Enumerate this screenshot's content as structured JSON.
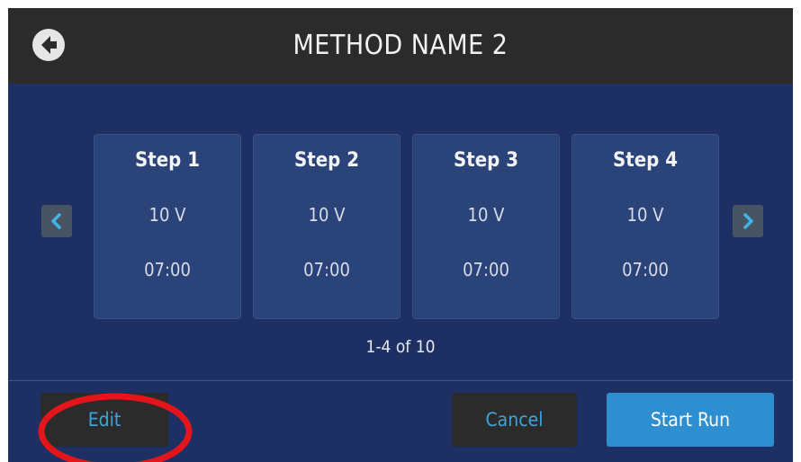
{
  "header": {
    "title": "METHOD NAME 2",
    "back_icon": "back-arrow-circle-icon"
  },
  "steps": [
    {
      "name": "Step 1",
      "voltage": "10 V",
      "time": "07:00"
    },
    {
      "name": "Step 2",
      "voltage": "10 V",
      "time": "07:00"
    },
    {
      "name": "Step 3",
      "voltage": "10 V",
      "time": "07:00"
    },
    {
      "name": "Step 4",
      "voltage": "10 V",
      "time": "07:00"
    }
  ],
  "nav": {
    "prev_icon": "chevron-left-icon",
    "next_icon": "chevron-right-icon",
    "pager": "1-4 of 10"
  },
  "footer": {
    "edit_label": "Edit",
    "cancel_label": "Cancel",
    "start_label": "Start Run"
  },
  "colors": {
    "background": "#1d2f63",
    "header": "#2b2b2b",
    "card": "#2a4378",
    "accent": "#3ea3d8",
    "primary_button": "#2e8fd0",
    "annotation": "#e4141b"
  }
}
